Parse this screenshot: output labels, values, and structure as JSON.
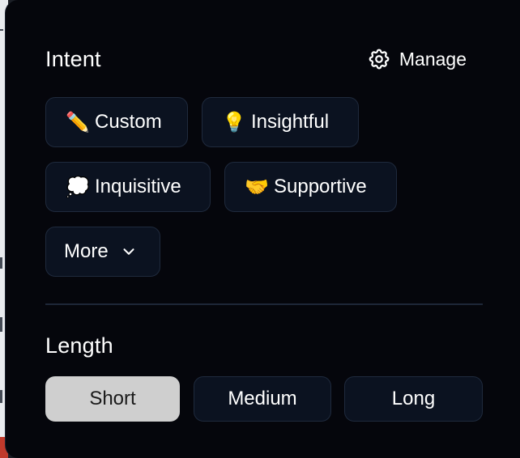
{
  "intent": {
    "title": "Intent",
    "manage_label": "Manage",
    "chips": [
      {
        "label": "Custom",
        "emoji": "✏️"
      },
      {
        "label": "Insightful",
        "emoji": "💡"
      },
      {
        "label": "Inquisitive",
        "emoji": "💭"
      },
      {
        "label": "Supportive",
        "emoji": "🤝"
      }
    ],
    "more_label": "More"
  },
  "length": {
    "title": "Length",
    "options": [
      "Short",
      "Medium",
      "Long"
    ],
    "selected": "Short"
  },
  "colors": {
    "panel_bg": "#05060c",
    "chip_bg": "#0b1220",
    "chip_border": "#1f2a3d",
    "selected_bg": "#cfcfcf",
    "text": "#ffffff"
  }
}
